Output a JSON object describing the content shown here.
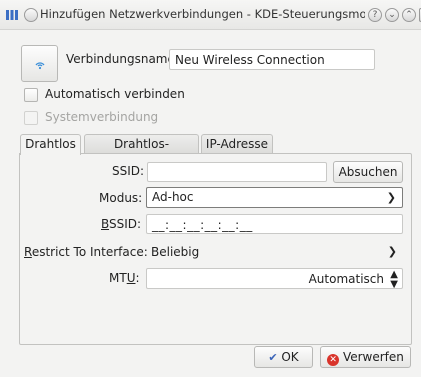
{
  "window": {
    "title": "Hinzufügen Netzwerkverbindungen - KDE-Steuerungsmodul",
    "controls": [
      "help-icon",
      "minimize-icon",
      "maximize-icon",
      "close-icon"
    ]
  },
  "connection": {
    "name_label": "Verbindungsname",
    "name_value": "Neu Wireless Connection",
    "icon": "wireless-signal-icon"
  },
  "options": {
    "auto_connect_label": "Automatisch verbinden",
    "system_connection_label": "Systemverbindung"
  },
  "tabs": [
    {
      "label": "Drahtlos",
      "active": true
    },
    {
      "label": "Drahtlos-Sicherheit",
      "active": false
    },
    {
      "label": "IP-Adresse",
      "active": false
    }
  ],
  "wireless": {
    "ssid_label": "SSID:",
    "ssid_value": "",
    "scan_button": "Absuchen",
    "mode_label": "Modus:",
    "mode_value": "Ad-hoc",
    "bssid_label_pre": "",
    "bssid_label_mnemonic": "B",
    "bssid_label_post": "SSID:",
    "bssid_value": "__:__:__:__:__:__",
    "restrict_label_mnemonic": "R",
    "restrict_label_post": "estrict To Interface:",
    "restrict_value": "Beliebig",
    "mtu_label_pre": "MT",
    "mtu_label_mnemonic": "U",
    "mtu_label_post": ":",
    "mtu_value": "Automatisch"
  },
  "buttons": {
    "ok": "OK",
    "cancel": "Verwerfen"
  },
  "colors": {
    "accent": "#3c8fd8",
    "cancel_icon": "#d9342b",
    "ok_icon": "#3a63b8"
  }
}
